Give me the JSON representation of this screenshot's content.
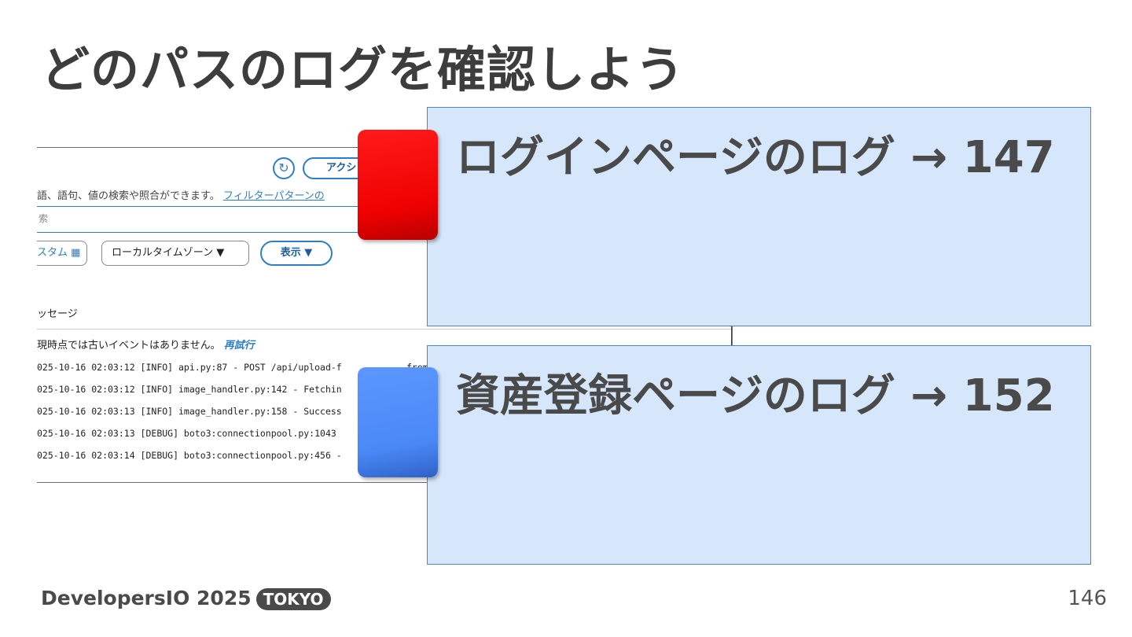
{
  "slide": {
    "title": "どのパスのログを確認しよう",
    "page_number": "146"
  },
  "footer": {
    "brand": "DevelopersIO 2025",
    "tag": "TOKYO"
  },
  "screenshot": {
    "action_label": "アクシ",
    "help_text": "語、語句、値の検索や照合ができます。",
    "help_link": "フィルターパターンの",
    "search_placeholder": "索",
    "custom_label": "スタム ▦",
    "timezone_label": "ローカルタイムゾーン ▼",
    "view_label": "表示 ▼",
    "column_header": "ッセージ",
    "notice_text": "現時点では古いイベントはありません。",
    "retry_link": "再試行",
    "log_lines": [
      "025-10-16 02:03:12 [INFO] api.py:87 - POST /api/upload-f",
      "025-10-16 02:03:12 [INFO] image_handler.py:142 - Fetchin",
      "025-10-16 02:03:13 [INFO] image_handler.py:158 - Success",
      "025-10-16 02:03:13 [DEBUG] boto3:connectionpool.py:1043",
      "025-10-16 02:03:14 [DEBUG] boto3:connectionpool.py:456 -"
    ],
    "log_line_first_suffix": "from"
  },
  "callouts": [
    {
      "text": "ログインページのログ → 147",
      "marker_color": "#ee0000"
    },
    {
      "text": "資産登録ページのログ → 152",
      "marker_color": "#4a88f5"
    }
  ]
}
